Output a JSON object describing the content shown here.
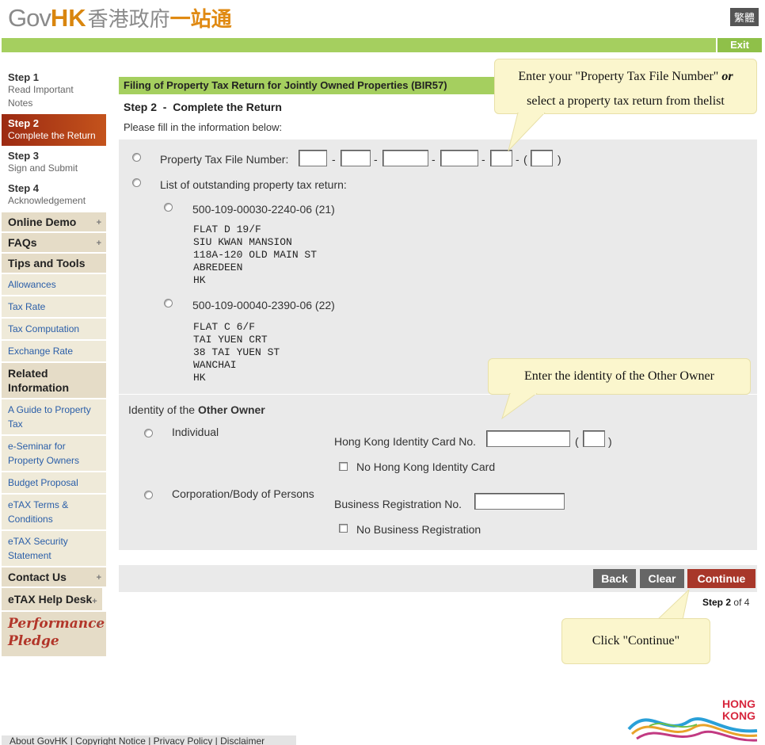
{
  "header": {
    "logo_gov": "Gov",
    "logo_hk": "HK",
    "logo_cn": "香港政府",
    "logo_cn2": "一站通",
    "lang": "繁體",
    "exit": "Exit"
  },
  "sidebar": {
    "steps": [
      {
        "title": "Step 1",
        "sub": "Read Important Notes"
      },
      {
        "title": "Step 2",
        "sub": "Complete the Return"
      },
      {
        "title": "Step 3",
        "sub": "Sign and Submit"
      },
      {
        "title": "Step 4",
        "sub": "Acknowledgement"
      }
    ],
    "online_demo": "Online Demo",
    "faqs": "FAQs",
    "tips_tools": "Tips and Tools",
    "tips_links": [
      "Allowances",
      "Tax Rate",
      "Tax Computation",
      "Exchange Rate"
    ],
    "related_info": "Related Information",
    "related_links": [
      "A Guide to Property Tax",
      "e-Seminar for Property Owners",
      "Budget Proposal",
      "eTAX Terms & Conditions",
      "eTAX Security Statement"
    ],
    "contact_us": "Contact Us",
    "help_desk": "eTAX Help Desk",
    "perf1": "Performance",
    "perf2": "Pledge",
    "plus": "+"
  },
  "main": {
    "title": "Filing of Property Tax Return for Jointly Owned Properties (BIR57)",
    "step_title": "Step 2  -  Complete the Return",
    "please": "Please fill in the information below:",
    "ptfn_label": "Property Tax File Number:",
    "dash": "-",
    "paren_open": "(",
    "paren_close": ")",
    "list_label": "List of outstanding property tax return:",
    "returns": [
      {
        "number": "500-109-00030-2240-06 (21)",
        "address": "FLAT D 19/F\nSIU KWAN MANSION\n118A-120 OLD MAIN ST\nABREDEEN\nHK"
      },
      {
        "number": "500-109-00040-2390-06 (22)",
        "address": "FLAT C 6/F\nTAI YUEN CRT\n38 TAI YUEN ST\nWANCHAI\nHK"
      }
    ],
    "identity_pre": "Identity of the ",
    "identity_bold": "Other Owner",
    "individual": "Individual",
    "hkid_label": "Hong Kong Identity Card No.",
    "no_hkid": "No Hong Kong Identity Card",
    "corp": "Corporation/Body of Persons",
    "br_label": "Business Registration No.",
    "no_br": "No Business Registration",
    "back": "Back",
    "clear": "Clear",
    "continue": "Continue",
    "step_word": "Step",
    "step_num": "2",
    "step_of": "of 4"
  },
  "callouts": {
    "c1_line1_pre": "Enter your \"Property Tax File Number\" ",
    "c1_or": "or",
    "c1_line2": "select a property tax return from thelist",
    "c2": "Enter the identity of the Other Owner",
    "c3": "Click \"Continue\""
  },
  "footer": {
    "links": "About GovHK | Copyright Notice | Privacy Policy | Disclaimer",
    "hk_logo_line1": "HONG",
    "hk_logo_line2": "KONG"
  },
  "colors": {
    "green": "#a5cf5f",
    "active_step": "#b2431a",
    "continue": "#a8372a",
    "callout": "#fbf6cd"
  }
}
